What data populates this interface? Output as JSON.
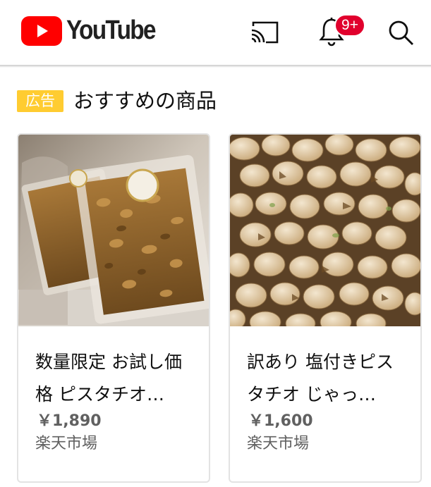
{
  "header": {
    "logo_text": "YouTube",
    "notification_count": "9+",
    "icons": [
      "youtube-logo-icon",
      "cast-icon",
      "bell-icon",
      "search-icon"
    ],
    "brand_color": "#ff0000",
    "badge_color": "#e1002d"
  },
  "section": {
    "ad_label": "広告",
    "ad_color": "#ffcc31",
    "title": "おすすめの商品"
  },
  "products": [
    {
      "title": "数量限定 お試し価格 ピスタチオ…",
      "price": "￥1,890",
      "seller": "楽天市場"
    },
    {
      "title": "訳あり 塩付きピスタチオ じゃっ…",
      "price": "￥1,600",
      "seller": "楽天市場"
    }
  ]
}
